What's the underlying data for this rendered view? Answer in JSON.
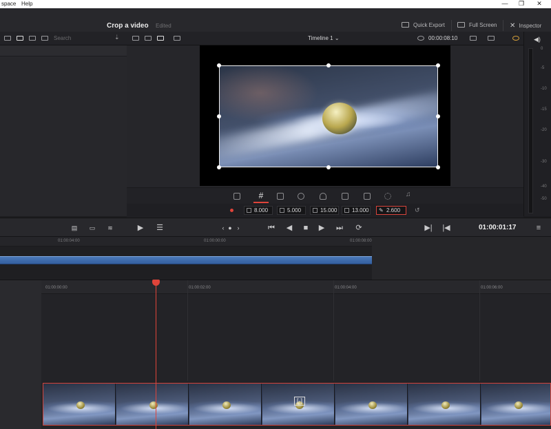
{
  "os_menu": {
    "workspace": "space",
    "help": "Help"
  },
  "window_controls": {
    "minimize": "—",
    "restore": "❐",
    "close": "✕"
  },
  "header": {
    "title": "Crop a video",
    "status": "Edited",
    "quick_export": "Quick Export",
    "full_screen": "Full Screen",
    "inspector": "Inspector"
  },
  "toolbar": {
    "search_placeholder": "Search",
    "timeline_name": "Timeline 1",
    "timecode": "00:00:08:10"
  },
  "inspector_params": {
    "width": "8.000",
    "height": "5.000",
    "left": "15.000",
    "right": "13.000",
    "softness": "2.600"
  },
  "transport": {
    "timecode": "01:00:01:17"
  },
  "upper_ruler": {
    "labels": [
      "01:00:04:00",
      "01:00:00:00",
      "01:00:08:00"
    ]
  },
  "main_ruler": {
    "labels": [
      "01:00:00:00",
      "01:00:02:00",
      "01:00:04:00",
      "01:00:06:00"
    ]
  },
  "meter_scale": [
    "0",
    "-5",
    "-10",
    "-15",
    "-20",
    "-30",
    "-40",
    "-50"
  ],
  "colors": {
    "accent_red": "#e0443a",
    "clip_blue": "#3f6cad",
    "background": "#1c1c1f"
  }
}
